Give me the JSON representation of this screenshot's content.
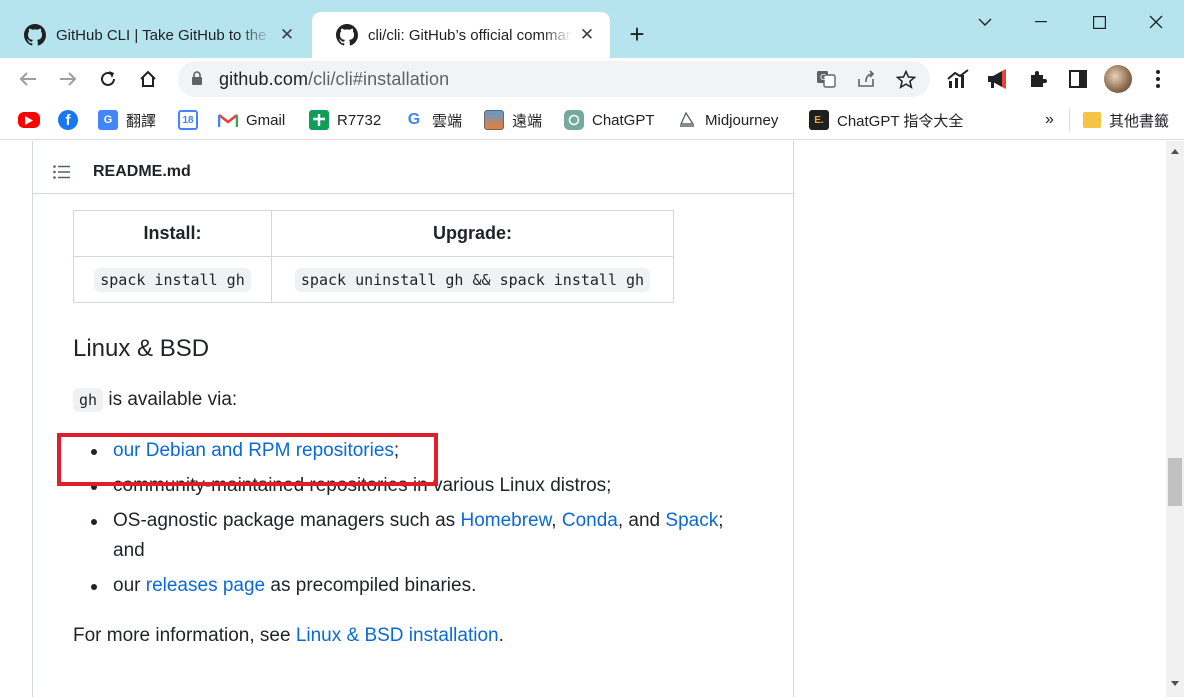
{
  "tabs": [
    {
      "title": "GitHub CLI | Take GitHub to the command line",
      "active": false
    },
    {
      "title": "cli/cli: GitHub’s official command line tool",
      "active": true
    }
  ],
  "window_controls": {
    "dropdown": "⌄",
    "minimize": "—",
    "maximize": "☐",
    "close": "✕"
  },
  "address_bar": {
    "host": "github.com",
    "path": "/cli/cli#installation"
  },
  "bookmarks": [
    {
      "label": "",
      "icon": "youtube-icon"
    },
    {
      "label": "",
      "icon": "facebook-icon"
    },
    {
      "label": "翻譯",
      "icon": "google-translate-icon"
    },
    {
      "label": "",
      "icon": "google-calendar-icon",
      "icon_text": "18"
    },
    {
      "label": "Gmail",
      "icon": "gmail-icon"
    },
    {
      "label": "R7732",
      "icon": "google-sheets-icon"
    },
    {
      "label": "雲端",
      "icon": "google-icon"
    },
    {
      "label": "遠端",
      "icon": "remote-desktop-icon"
    },
    {
      "label": "ChatGPT",
      "icon": "chatgpt-icon"
    },
    {
      "label": "Midjourney",
      "icon": "midjourney-icon"
    },
    {
      "label": "ChatGPT 指令大全",
      "icon": "e-icon",
      "icon_text": "E."
    }
  ],
  "bookmarks_overflow": "»",
  "other_bookmarks": "其他書籤",
  "readme": {
    "filename": "README.md",
    "table": {
      "headers": [
        "Install:",
        "Upgrade:"
      ],
      "row": [
        "spack install gh",
        "spack uninstall gh && spack install gh"
      ]
    },
    "heading": "Linux & BSD",
    "intro_code": "gh",
    "intro_text": "is available via:",
    "items": [
      {
        "link": "our Debian and RPM repositories",
        "after": ";"
      },
      {
        "text": "community-maintained repositories in various Linux distros;"
      },
      {
        "pre": "OS-agnostic package managers such as ",
        "link1": "Homebrew",
        "sep1": ", ",
        "link2": "Conda",
        "sep2": ", and ",
        "link3": "Spack",
        "after": ";",
        "cont": "and"
      },
      {
        "pre": "our ",
        "link": "releases page",
        "after": " as precompiled binaries."
      }
    ],
    "footer_pre": "For more information, see ",
    "footer_link": "Linux & BSD installation",
    "footer_after": "."
  },
  "colors": {
    "titlebar": "#b5e4ee",
    "link": "#0969da",
    "highlight": "#e01e2b"
  }
}
